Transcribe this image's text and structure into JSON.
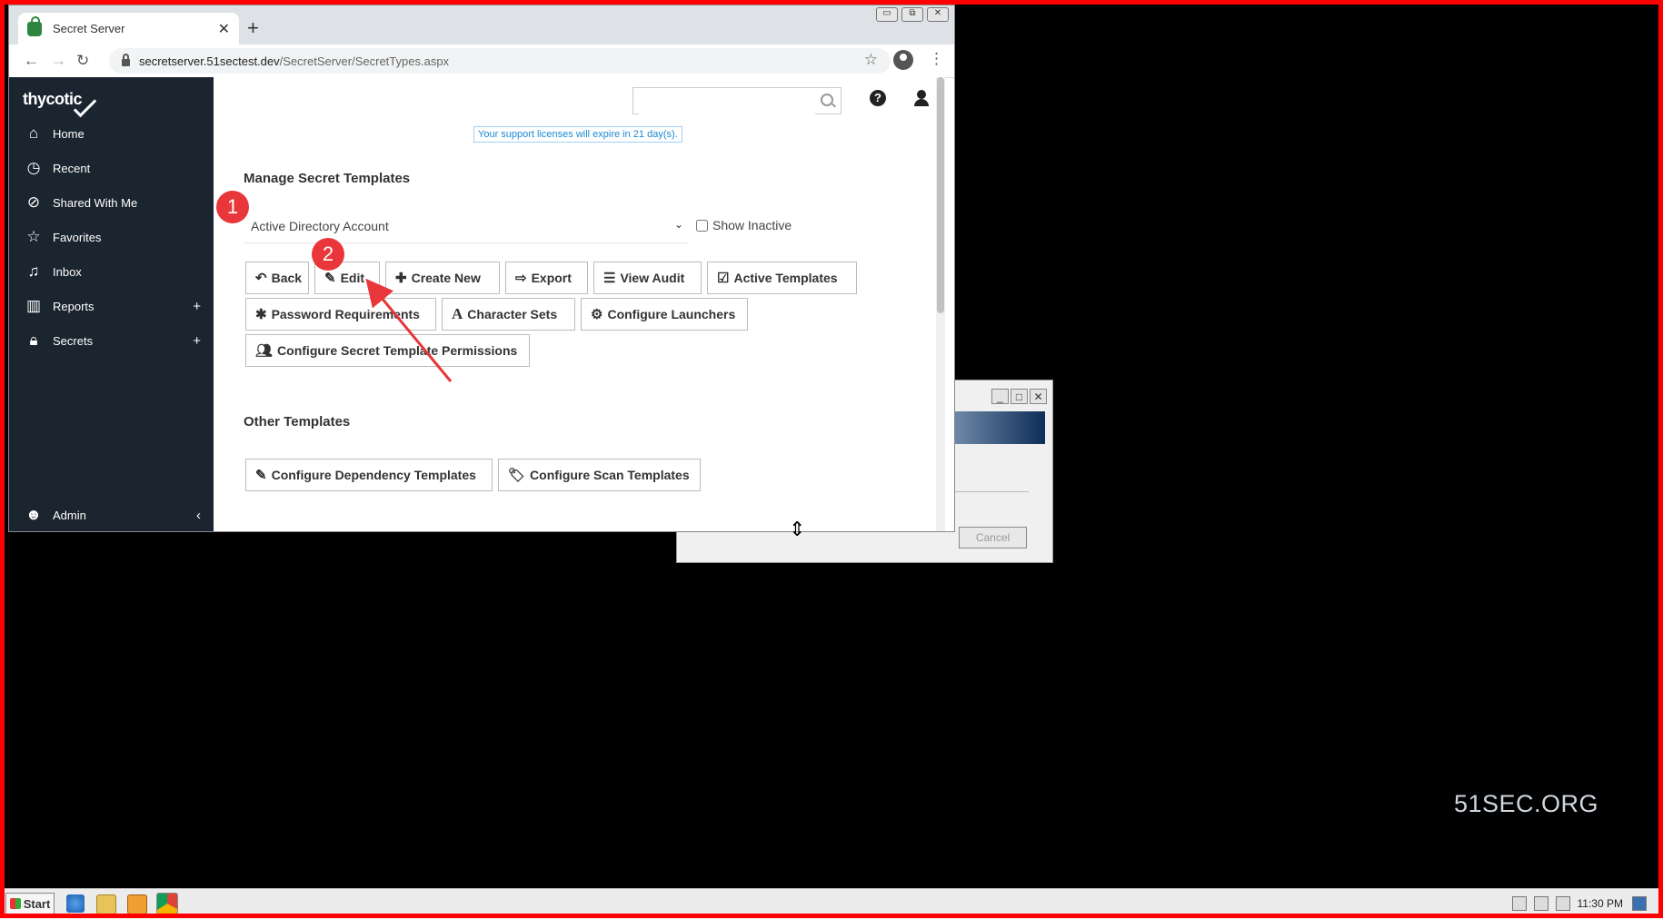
{
  "browser": {
    "tab_title": "Secret Server",
    "url_host": "secretserver.51sectest.dev",
    "url_path": "/SecretServer/SecretTypes.aspx"
  },
  "sidebar": {
    "logo": "thycotic",
    "items": [
      {
        "label": "Home",
        "icon": "home-icon"
      },
      {
        "label": "Recent",
        "icon": "clock-icon"
      },
      {
        "label": "Shared With Me",
        "icon": "share-icon"
      },
      {
        "label": "Favorites",
        "icon": "star-icon"
      },
      {
        "label": "Inbox",
        "icon": "bell-icon"
      },
      {
        "label": "Reports",
        "icon": "chart-icon",
        "expandable": true
      },
      {
        "label": "Secrets",
        "icon": "lock-icon",
        "expandable": true
      }
    ],
    "admin_label": "Admin"
  },
  "header": {
    "license_notice": "Your support licenses will expire in 21 day(s)."
  },
  "manage": {
    "heading": "Manage Secret Templates",
    "selected_template": "Active Directory Account",
    "show_inactive_label": "Show Inactive",
    "buttons": {
      "back": "Back",
      "edit": "Edit",
      "create_new": "Create New",
      "export": "Export",
      "view_audit": "View Audit",
      "active_templates": "Active Templates",
      "password_requirements": "Password Requirements",
      "character_sets": "Character Sets",
      "configure_launchers": "Configure Launchers",
      "configure_permissions": "Configure Secret Template Permissions"
    }
  },
  "other": {
    "heading": "Other Templates",
    "buttons": {
      "dependency": "Configure Dependency Templates",
      "scan": "Configure Scan Templates"
    }
  },
  "annotations": {
    "step1": "1",
    "step2": "2",
    "color": "#e8363a"
  },
  "dialog": {
    "cancel_label": "Cancel"
  },
  "taskbar": {
    "start_label": "Start",
    "clock": "11:30 PM"
  },
  "watermark": "51SEC.ORG"
}
